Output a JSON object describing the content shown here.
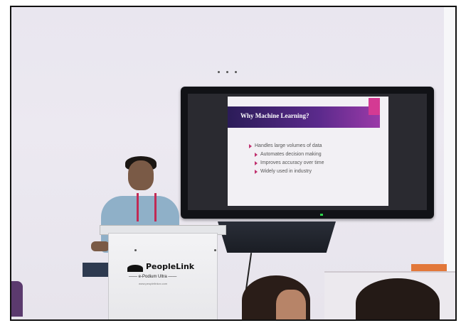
{
  "slide": {
    "title": "Why Machine Learning?",
    "bullets": [
      "Handles large volumes of data",
      "Automates decision making",
      "Improves accuracy over time",
      "Widely used in industry"
    ]
  },
  "podium": {
    "brand": "PeopleLink",
    "model": "e-Podium Ultra",
    "url": "www.peoplelinkvc.com"
  },
  "colors": {
    "slide_header": "#4a2478",
    "slide_accent": "#d43a93",
    "bullet_marker": "#c0306e",
    "shirt": "#8fb0c8",
    "lanyard": "#c12a55"
  }
}
